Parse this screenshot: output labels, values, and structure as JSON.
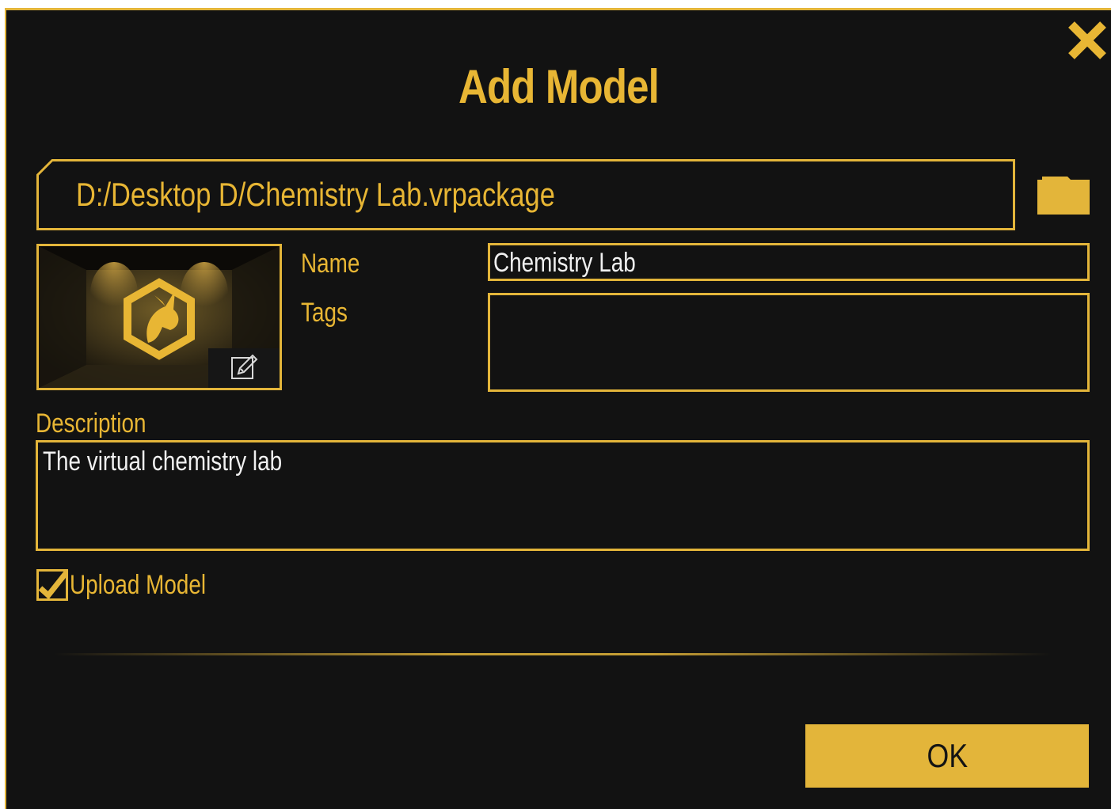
{
  "dialog": {
    "title": "Add Model",
    "close_icon": "close-icon",
    "accent_color": "#e3b53a",
    "background_color": "#121212"
  },
  "file": {
    "path": "D:/Desktop D/Chemistry Lab.vrpackage",
    "browse_icon": "folder-icon"
  },
  "thumbnail": {
    "logo_icon": "dragon-logo-icon",
    "edit_icon": "edit-pencil-icon"
  },
  "form": {
    "name_label": "Name",
    "name_value": "Chemistry Lab",
    "tags_label": "Tags",
    "tags_value": "",
    "description_label": "Description",
    "description_value": "The virtual chemistry lab",
    "upload_label": "Upload Model",
    "upload_checked": true
  },
  "actions": {
    "ok_label": "OK"
  }
}
